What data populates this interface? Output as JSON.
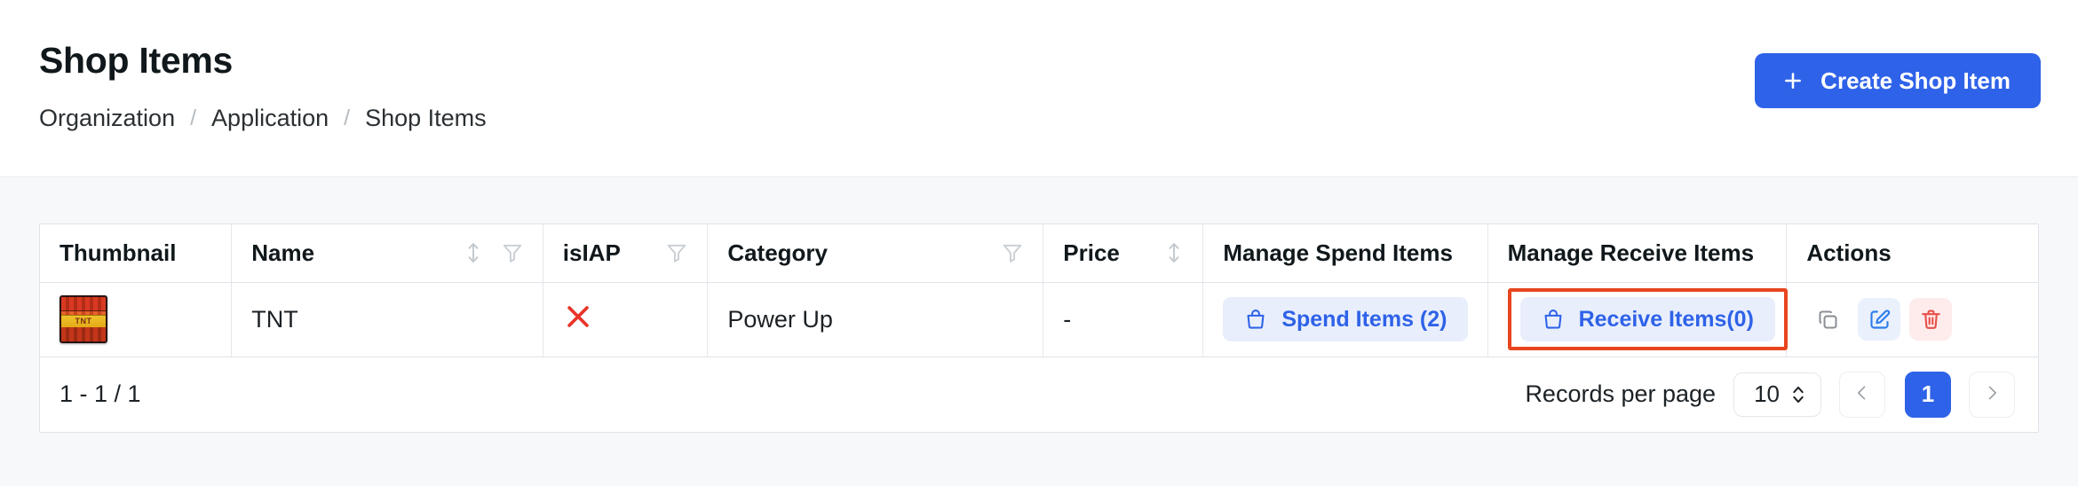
{
  "header": {
    "title": "Shop Items",
    "breadcrumb": [
      {
        "label": "Organization"
      },
      {
        "label": "Application"
      },
      {
        "label": "Shop Items"
      }
    ],
    "breadcrumb_separator": "/",
    "create_button": {
      "label": "Create Shop Item",
      "icon": "plus-icon",
      "color": "#2e62e8"
    }
  },
  "table": {
    "columns": [
      {
        "label": "Thumbnail",
        "sortable": false,
        "filterable": false
      },
      {
        "label": "Name",
        "sortable": true,
        "filterable": true
      },
      {
        "label": "isIAP",
        "sortable": false,
        "filterable": true
      },
      {
        "label": "Category",
        "sortable": false,
        "filterable": true
      },
      {
        "label": "Price",
        "sortable": true,
        "filterable": false
      },
      {
        "label": "Manage Spend Items",
        "sortable": false,
        "filterable": false
      },
      {
        "label": "Manage Receive Items",
        "sortable": false,
        "filterable": false
      },
      {
        "label": "Actions",
        "sortable": false,
        "filterable": false
      }
    ],
    "rows": [
      {
        "thumbnail": "tnt-block-image",
        "name": "TNT",
        "isIAP": false,
        "isIAP_icon": "x-mark-icon",
        "category": "Power Up",
        "price": "-",
        "spend_items": {
          "label": "Spend Items (2)",
          "icon": "shopping-bag-icon",
          "count": 2
        },
        "receive_items": {
          "label": "Receive Items(0)",
          "icon": "shopping-bag-icon",
          "count": 0,
          "highlighted": true,
          "highlight_color": "#e8461f"
        },
        "actions": [
          {
            "name": "duplicate-button",
            "icon": "copy-icon",
            "color": "#8b9096"
          },
          {
            "name": "edit-button",
            "icon": "edit-pencil-icon",
            "color": "#2e7ce8"
          },
          {
            "name": "delete-button",
            "icon": "trash-icon",
            "color": "#e8504a"
          }
        ]
      }
    ]
  },
  "pagination": {
    "range": "1 - 1 / 1",
    "records_per_page_label": "Records per page",
    "records_per_page_value": "10",
    "prev_label": "‹",
    "next_label": "›",
    "pages": [
      {
        "label": "1",
        "active": true
      }
    ]
  }
}
